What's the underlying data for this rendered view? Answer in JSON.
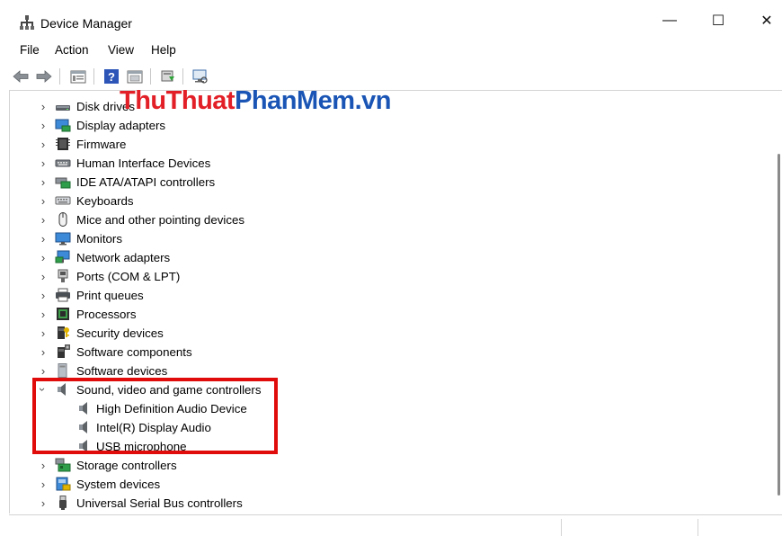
{
  "window": {
    "title": "Device Manager",
    "minimize_glyph": "—",
    "maximize_glyph": "☐",
    "close_glyph": "✕"
  },
  "menu": [
    "File",
    "Action",
    "View",
    "Help"
  ],
  "toolbar": {
    "buttons": [
      "back-icon",
      "forward-icon",
      "properties-icon",
      "help-icon",
      "show-hidden-icon",
      "update-driver-icon",
      "scan-hardware-icon"
    ]
  },
  "watermark": {
    "part1": "ThuThuat",
    "part2": "PhanMem",
    "part3": ".vn"
  },
  "tree": {
    "categories": [
      {
        "label": "Disk drives",
        "icon": "disk-drive-icon",
        "expanded": false
      },
      {
        "label": "Display adapters",
        "icon": "display-adapter-icon",
        "expanded": false
      },
      {
        "label": "Firmware",
        "icon": "firmware-icon",
        "expanded": false
      },
      {
        "label": "Human Interface Devices",
        "icon": "hid-icon",
        "expanded": false
      },
      {
        "label": "IDE ATA/ATAPI controllers",
        "icon": "ide-controller-icon",
        "expanded": false
      },
      {
        "label": "Keyboards",
        "icon": "keyboard-icon",
        "expanded": false
      },
      {
        "label": "Mice and other pointing devices",
        "icon": "mouse-icon",
        "expanded": false
      },
      {
        "label": "Monitors",
        "icon": "monitor-icon",
        "expanded": false
      },
      {
        "label": "Network adapters",
        "icon": "network-adapter-icon",
        "expanded": false
      },
      {
        "label": "Ports (COM & LPT)",
        "icon": "port-icon",
        "expanded": false
      },
      {
        "label": "Print queues",
        "icon": "printer-icon",
        "expanded": false
      },
      {
        "label": "Processors",
        "icon": "processor-icon",
        "expanded": false
      },
      {
        "label": "Security devices",
        "icon": "security-device-icon",
        "expanded": false
      },
      {
        "label": "Software components",
        "icon": "software-component-icon",
        "expanded": false
      },
      {
        "label": "Software devices",
        "icon": "software-device-icon",
        "expanded": false
      },
      {
        "label": "Sound, video and game controllers",
        "icon": "speaker-icon",
        "expanded": true
      },
      {
        "label": "Storage controllers",
        "icon": "storage-controller-icon",
        "expanded": false
      },
      {
        "label": "System devices",
        "icon": "system-device-icon",
        "expanded": false
      },
      {
        "label": "Universal Serial Bus controllers",
        "icon": "usb-icon",
        "expanded": false
      }
    ],
    "sound_children": [
      {
        "label": "High Definition Audio Device",
        "icon": "speaker-icon"
      },
      {
        "label": "Intel(R) Display Audio",
        "icon": "speaker-icon"
      },
      {
        "label": "USB microphone",
        "icon": "speaker-icon"
      }
    ]
  },
  "colors": {
    "highlight": "#e00b0b",
    "watermark_red": "#e21f26",
    "watermark_blue": "#1a55b5"
  }
}
